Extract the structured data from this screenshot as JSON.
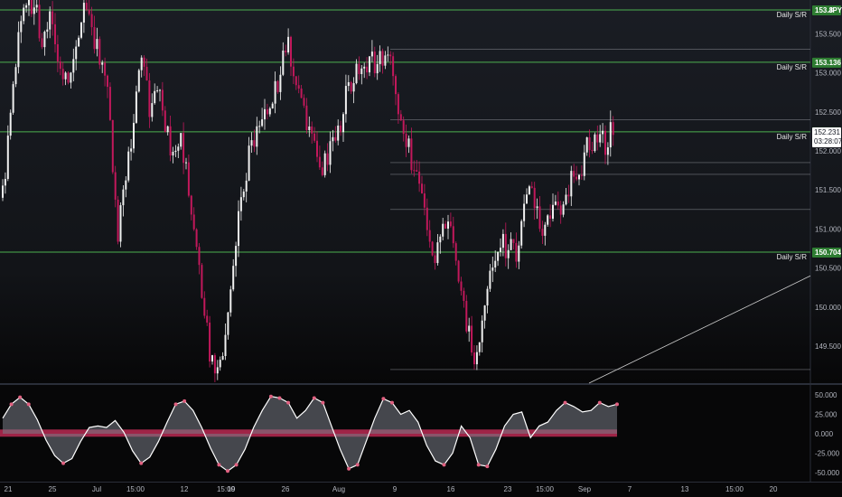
{
  "chart_data": [
    {
      "type": "candlestick",
      "symbol_currency": "JPY",
      "y_ticks": [
        153.5,
        153.0,
        152.5,
        152.0,
        151.5,
        151.0,
        150.5,
        150.0,
        149.5
      ],
      "y_tick_labels": [
        "153.500",
        "153.000",
        "152.500",
        "152.000",
        "151.500",
        "151.000",
        "150.500",
        "150.000",
        "149.500"
      ],
      "ylim": [
        149.0,
        154.0
      ],
      "x_tick_labels": [
        "21",
        "25",
        "Jul",
        "15:00",
        "12",
        "15:00",
        "19",
        "26",
        "Aug",
        "9",
        "16",
        "23",
        "15:00",
        "Sep",
        "7",
        "13",
        "15:00",
        "20"
      ],
      "current_price": "152.231",
      "countdown": "03:28:07",
      "support_resistance": [
        {
          "label": "Daily S/R",
          "price": 153.8,
          "price_label": "153.8"
        },
        {
          "label": "Daily S/R",
          "price": 153.136,
          "price_label": "153.136"
        },
        {
          "label": "Daily S/R",
          "price": 152.245,
          "price_label": "152.245"
        },
        {
          "label": "Daily S/R",
          "price": 150.704,
          "price_label": "150.704"
        }
      ],
      "path_prices": [
        151.4,
        152.6,
        153.6,
        154.0,
        153.8,
        153.4,
        153.7,
        153.2,
        152.9,
        153.4,
        153.8,
        153.5,
        153.1,
        152.8,
        150.9,
        151.5,
        152.3,
        153.1,
        152.6,
        152.9,
        152.3,
        151.8,
        152.1,
        151.5,
        150.6,
        149.7,
        149.1,
        149.5,
        150.2,
        151.1,
        151.8,
        152.2,
        152.5,
        152.6,
        152.9,
        153.4,
        152.9,
        152.5,
        152.1,
        151.7,
        151.9,
        152.2,
        152.6,
        153.0,
        153.1,
        153.2,
        153.1,
        153.3,
        153.0,
        152.4,
        152.0,
        151.6,
        151.2,
        150.7,
        150.9,
        151.2,
        150.3,
        149.8,
        149.2,
        149.8,
        150.4,
        150.9,
        150.7,
        150.7,
        151.2,
        151.5,
        151.1,
        151.0,
        151.3,
        151.4,
        151.6,
        151.8,
        152.1,
        152.2,
        152.1,
        152.3
      ],
      "horizontal_levels": [
        153.3,
        152.4,
        151.85,
        151.7,
        151.25,
        149.2
      ],
      "trendline": {
        "from": {
          "x_label": "23",
          "price": 149.0
        },
        "to": {
          "x_label": "20",
          "price": 150.4
        }
      }
    },
    {
      "type": "line",
      "name": "oscillator",
      "y_ticks": [
        50,
        25,
        0,
        -25,
        -50
      ],
      "y_tick_labels": [
        "50.000",
        "25.000",
        "0.000",
        "-25.000",
        "-50.000"
      ],
      "ylim": [
        -60,
        60
      ],
      "band": [
        -2,
        2
      ],
      "values": [
        20,
        38,
        47,
        38,
        18,
        -8,
        -28,
        -38,
        -32,
        -10,
        8,
        10,
        8,
        17,
        2,
        -22,
        -38,
        -30,
        -10,
        15,
        38,
        42,
        30,
        8,
        -18,
        -40,
        -48,
        -40,
        -20,
        8,
        30,
        48,
        46,
        40,
        20,
        30,
        46,
        40,
        10,
        -20,
        -45,
        -40,
        -10,
        20,
        45,
        40,
        25,
        30,
        15,
        -15,
        -35,
        -40,
        -25,
        10,
        -5,
        -40,
        -42,
        -20,
        10,
        25,
        28,
        -5,
        10,
        15,
        30,
        40,
        35,
        28,
        30,
        40,
        35,
        38
      ]
    }
  ],
  "colors": {
    "bull_candle": "#f0f0f0",
    "bear_candle": "#c2185b",
    "sr_line": "#4caf50",
    "sr_tag": "#2e7d32",
    "level_line": "#8a8d94",
    "oscillator_line": "#ffffff",
    "oscillator_fill": "#787b86",
    "band": "#b0284f",
    "extreme_marker": "#e06080"
  }
}
